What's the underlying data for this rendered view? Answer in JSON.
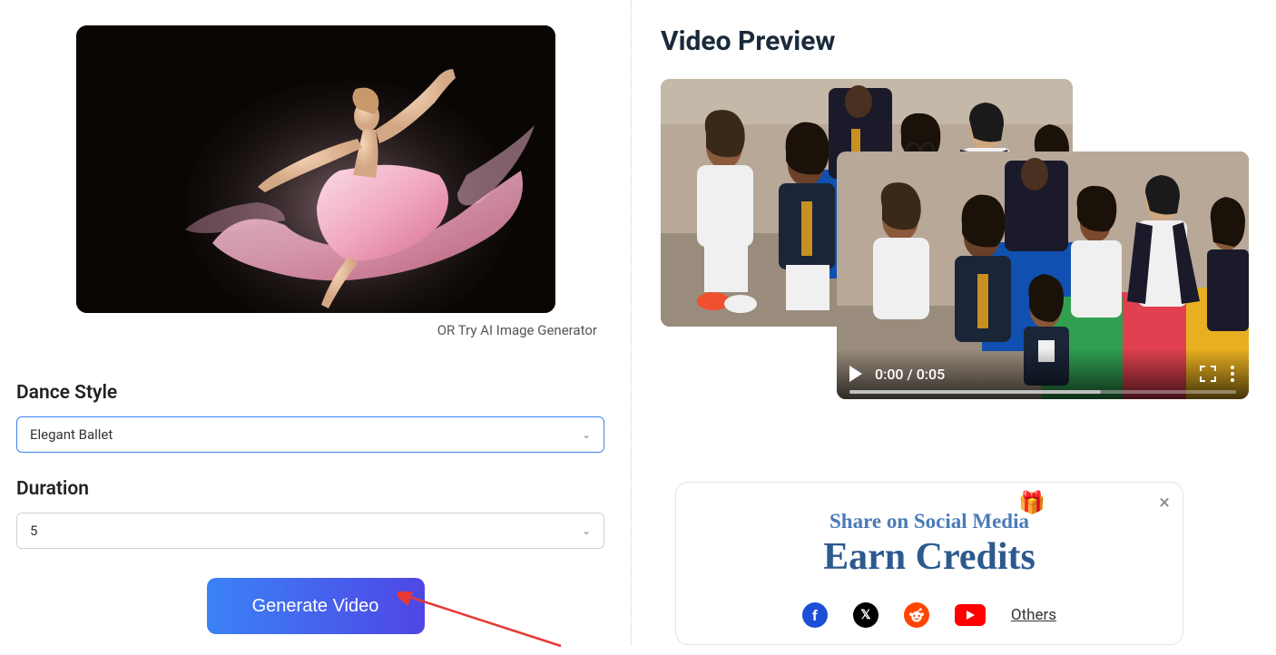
{
  "left": {
    "or_try_text": "OR Try ",
    "ai_gen_link": "AI Image Generator",
    "dance_style_label": "Dance Style",
    "dance_style_value": "Elegant Ballet",
    "duration_label": "Duration",
    "duration_value": "5",
    "generate_button": "Generate Video"
  },
  "right": {
    "preview_title": "Video Preview",
    "video_time": "0:00 / 0:05"
  },
  "share": {
    "title": "Share on Social Media",
    "subtitle": "Earn Credits",
    "others": "Others"
  }
}
